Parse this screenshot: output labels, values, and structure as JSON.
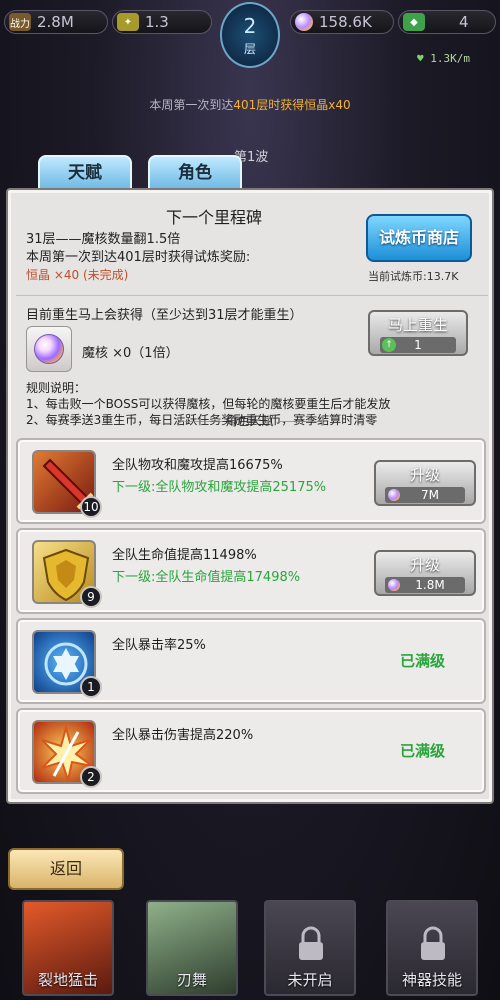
{
  "hud": {
    "power_label": "战力",
    "power_value": "2.8M",
    "level_value": "1.3",
    "floor_number": "2",
    "floor_unit": "层",
    "currency_value": "158.6K",
    "gems_value": "4",
    "rate": "1.3K/m"
  },
  "banner": {
    "week_note_prefix": "本周第一次到达",
    "week_note_floor": "401层时获得",
    "week_note_reward": "恒晶x40",
    "wave": "第1波"
  },
  "tabs": [
    {
      "label": "天赋"
    },
    {
      "label": "角色"
    }
  ],
  "milestone": {
    "title": "下一个里程碑",
    "line1": "31层——魔核数量翻1.5倍",
    "line2": "本周第一次到达401层时获得试炼奖励:",
    "line3": "恒晶 ×40 (未完成)",
    "shop_button": "试炼币商店",
    "coins_label": "当前试炼币:13.7K"
  },
  "rebirth": {
    "line1": "目前重生马上会获得（至少达到31层才能重生）",
    "core_text": "魔核  ×0（1倍）",
    "button_label": "马上重生",
    "button_cost": "1",
    "rules_title": "规则说明：",
    "rule1": "1、每击败一个BOSS可以获得魔核，但每轮的魔核要重生后才能发放",
    "rule2": "2、每赛季送3重生币，每日活跃任务奖励重生币，赛季结算时清零"
  },
  "talent_header": "角色天赋",
  "talents": [
    {
      "name": "全队物攻和魔攻提高16675%",
      "next": "下一级:全队物攻和魔攻提高25175%",
      "level": "10",
      "button": "升级",
      "cost": "7M",
      "maxed": ""
    },
    {
      "name": "全队生命值提高11498%",
      "next": "下一级:全队生命值提高17498%",
      "level": "9",
      "button": "升级",
      "cost": "1.8M",
      "maxed": ""
    },
    {
      "name": "全队暴击率25%",
      "next": "",
      "level": "1",
      "button": "",
      "cost": "",
      "maxed": "已满级"
    },
    {
      "name": "全队暴击伤害提高220%",
      "next": "",
      "level": "2",
      "button": "",
      "cost": "",
      "maxed": "已满级"
    }
  ],
  "back_button": "返回",
  "skills": [
    {
      "label": "裂地猛击"
    },
    {
      "label": "刃舞"
    },
    {
      "label": "未开启"
    },
    {
      "label": "神器技能"
    }
  ],
  "colors": {
    "accent_blue": "#1d8fd8",
    "green_text": "#2aa53c",
    "warning_orange": "#c0502c"
  }
}
